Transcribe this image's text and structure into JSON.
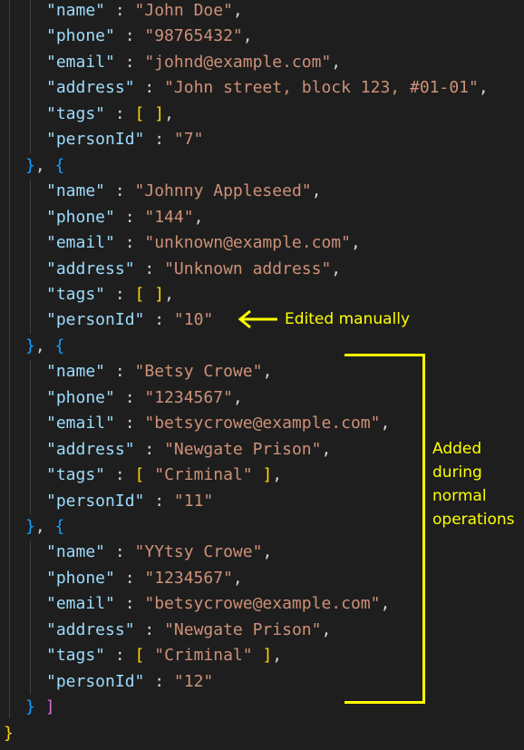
{
  "colors": {
    "background": "#1e1e1e",
    "key": "#9cdcfe",
    "string": "#ce9178",
    "punctuation": "#d4d4d4",
    "bracket_object": "#179fff",
    "bracket_inner": "#ffd700",
    "bracket_array": "#da70d6",
    "annotation": "#ffff00"
  },
  "persons": [
    {
      "name": "John Doe",
      "phone": "98765432",
      "email": "johnd@example.com",
      "address": "John street, block 123, #01-01",
      "tags": [],
      "personId": "7"
    },
    {
      "name": "Johnny Appleseed",
      "phone": "144",
      "email": "unknown@example.com",
      "address": "Unknown address",
      "tags": [],
      "personId": "10"
    },
    {
      "name": "Betsy Crowe",
      "phone": "1234567",
      "email": "betsycrowe@example.com",
      "address": "Newgate Prison",
      "tags": [
        "Criminal"
      ],
      "personId": "11"
    },
    {
      "name": "YYtsy Crowe",
      "phone": "1234567",
      "email": "betsycrowe@example.com",
      "address": "Newgate Prison",
      "tags": [
        "Criminal"
      ],
      "personId": "12"
    }
  ],
  "annotations": {
    "edited": "Edited manually",
    "added_lines": [
      "Added",
      "during",
      "normal",
      "operations"
    ]
  }
}
